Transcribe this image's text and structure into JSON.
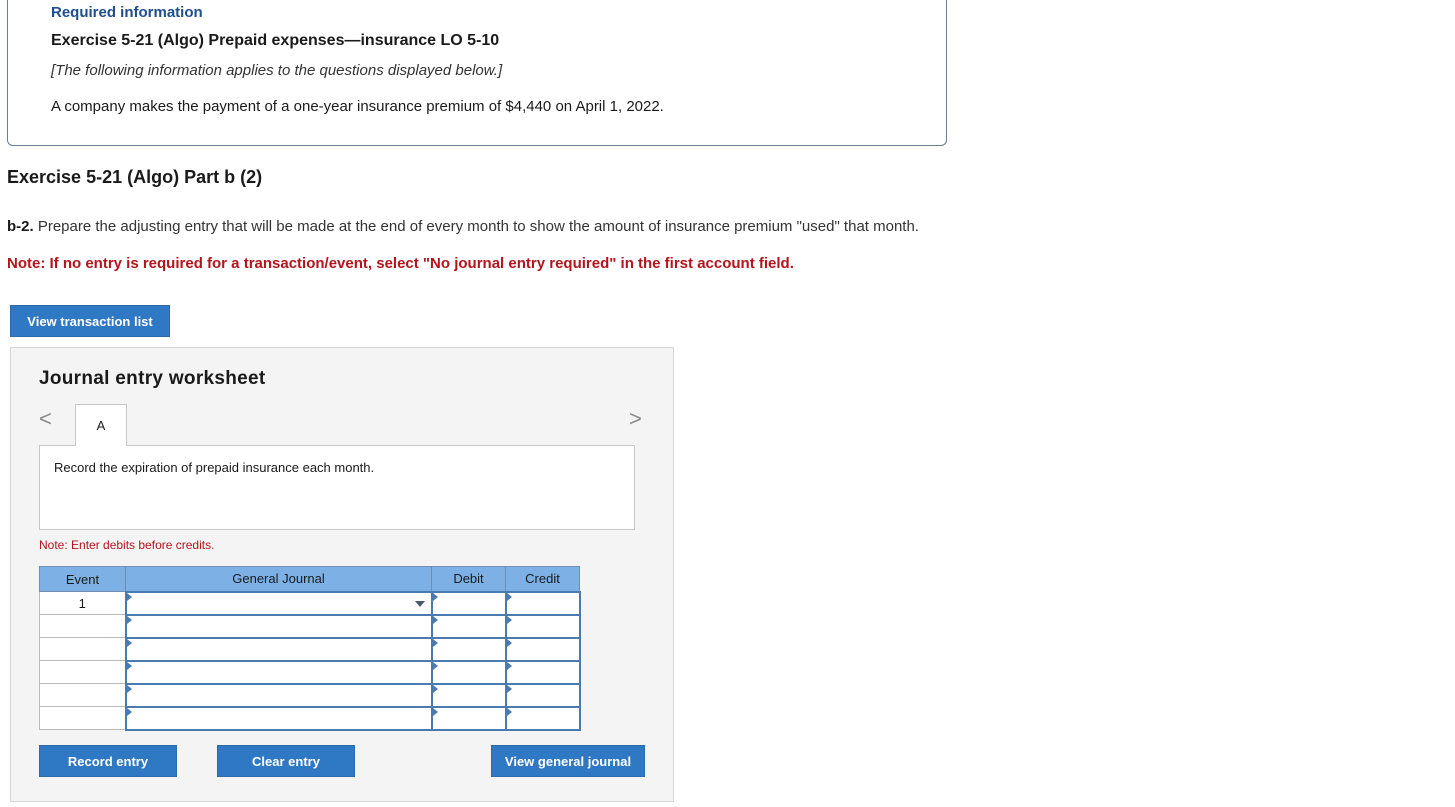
{
  "info": {
    "required_label": "Required information",
    "exercise_title": "Exercise 5-21 (Algo) Prepaid expenses—insurance LO 5-10",
    "applies_text": "[The following information applies to the questions displayed below.]",
    "statement": "A company makes the payment of a one-year insurance premium of $4,440 on April 1, 2022."
  },
  "part_title": "Exercise 5-21 (Algo) Part b (2)",
  "question": {
    "number": "b-2.",
    "text": " Prepare the adjusting entry that will be made at the end of every month to show the amount of insurance premium \"used\" that month.",
    "note": "Note: If no entry is required for a transaction/event, select \"No journal entry required\" in the first account field."
  },
  "buttons": {
    "view_transaction_list": "View transaction list",
    "record_entry": "Record entry",
    "clear_entry": "Clear entry",
    "view_general_journal": "View general journal"
  },
  "worksheet": {
    "title": "Journal entry worksheet",
    "nav_prev": "<",
    "nav_next": ">",
    "tab_label": "A",
    "instruction": "Record the expiration of prepaid insurance each month.",
    "note": "Note: Enter debits before credits.",
    "columns": [
      "Event",
      "General Journal",
      "Debit",
      "Credit"
    ],
    "rows": [
      {
        "event": "1",
        "account": "",
        "debit": "",
        "credit": ""
      },
      {
        "event": "",
        "account": "",
        "debit": "",
        "credit": ""
      },
      {
        "event": "",
        "account": "",
        "debit": "",
        "credit": ""
      },
      {
        "event": "",
        "account": "",
        "debit": "",
        "credit": ""
      },
      {
        "event": "",
        "account": "",
        "debit": "",
        "credit": ""
      },
      {
        "event": "",
        "account": "",
        "debit": "",
        "credit": ""
      }
    ]
  },
  "colors": {
    "button_blue": "#2f78c4",
    "header_blue": "#7db1e6",
    "note_red": "#b4141c",
    "title_blue": "#1f4e8c"
  }
}
